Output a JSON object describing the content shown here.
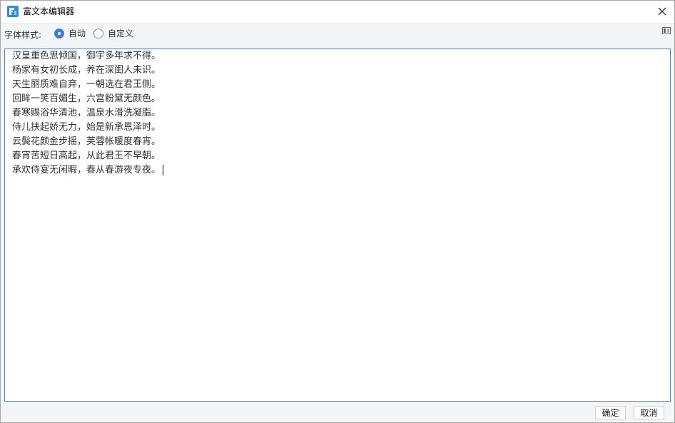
{
  "window": {
    "title": "富文本编辑器",
    "app_icon": "fine-report-logo-icon",
    "close_icon": "close-icon",
    "accent_color": "#3b7fe0",
    "border_color": "#3d8ad6"
  },
  "toolbar": {
    "style_label": "字体样式:",
    "options": [
      {
        "label": "自动",
        "checked": true
      },
      {
        "label": "自定义",
        "checked": false
      }
    ],
    "expand_icon": "expand-panel-icon"
  },
  "editor": {
    "lines": [
      "汉皇重色思倾国，御宇多年求不得。",
      "杨家有女初长成，养在深闺人未识。",
      "天生丽质难自弃，一朝选在君王侧。",
      "回眸一笑百媚生，六宫粉黛无颜色。",
      "春寒赐浴华清池，温泉水滑洗凝脂。",
      "侍儿扶起娇无力，始是新承恩泽时。",
      "云鬓花颜金步摇，芙蓉帐暖度春宵。",
      "春宵苦短日高起，从此君王不早朝。",
      "承欢侍宴无闲暇，春从春游夜专夜。"
    ]
  },
  "footer": {
    "ok_label": "确定",
    "cancel_label": "取消"
  }
}
